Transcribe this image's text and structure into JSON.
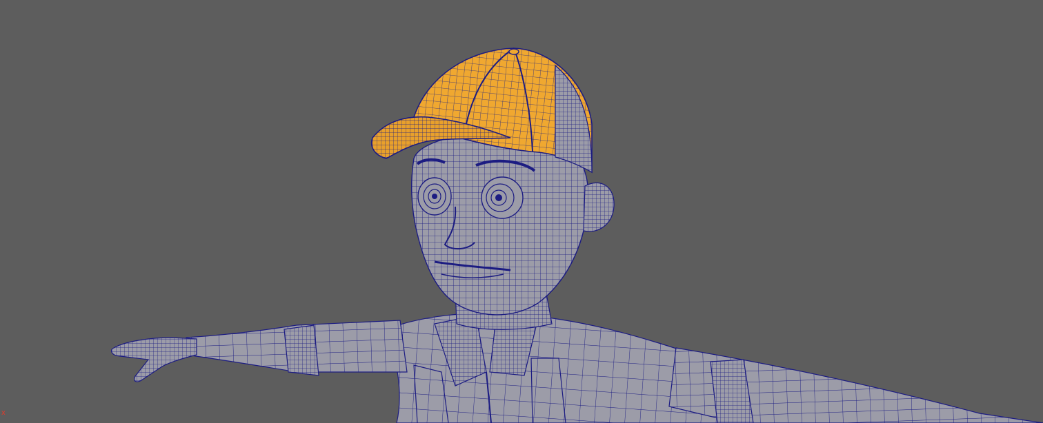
{
  "viewport": {
    "background": "#5d5d5d",
    "mesh_color": "#9c9ca8",
    "wire_color": "#1c1c82",
    "selection_color": "#f0a830",
    "selected_object": "baseball-cap",
    "axis_label": "x",
    "axis_color": "#e03a2a"
  }
}
